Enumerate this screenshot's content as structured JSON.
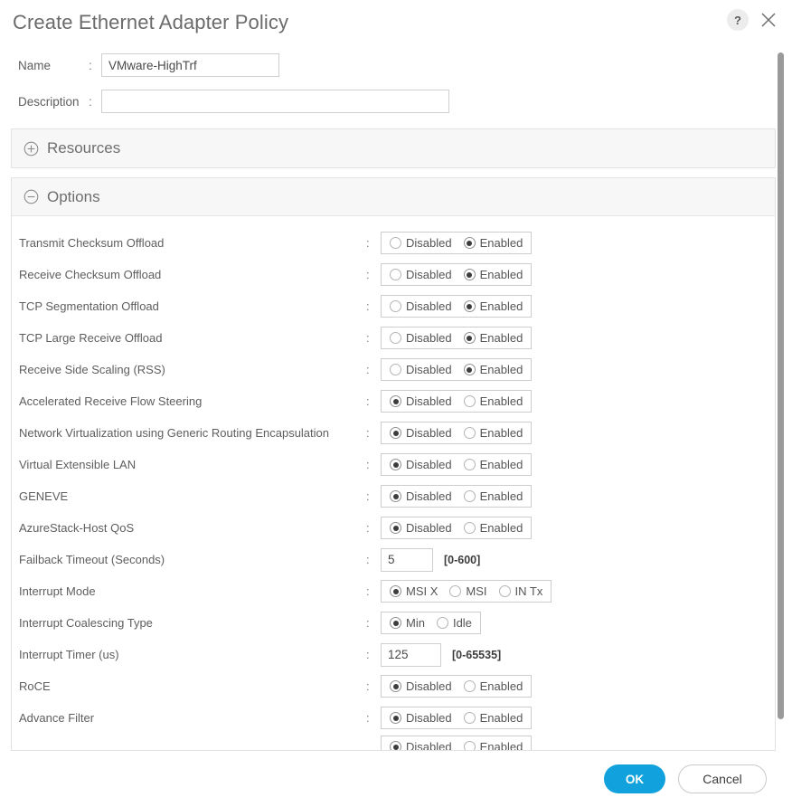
{
  "header": {
    "title": "Create Ethernet Adapter Policy",
    "help_icon": "question-mark-icon",
    "help_label": "?",
    "close_icon": "close-icon"
  },
  "form": {
    "name": {
      "label": "Name",
      "colon": ":",
      "value": "VMware-HighTrf",
      "placeholder": ""
    },
    "description": {
      "label": "Description",
      "colon": ":",
      "value": "",
      "placeholder": ""
    }
  },
  "sections": {
    "resources": {
      "title": "Resources",
      "expanded": false,
      "toggle_glyph": "plus-circle-icon"
    },
    "options": {
      "title": "Options",
      "expanded": true,
      "toggle_glyph": "minus-circle-icon"
    }
  },
  "radio_labels": {
    "disabled": "Disabled",
    "enabled": "Enabled"
  },
  "options_rows": [
    {
      "label": "Transmit Checksum Offload",
      "colon": ":",
      "type": "radio",
      "choices": [
        "Disabled",
        "Enabled"
      ],
      "selected": "Enabled"
    },
    {
      "label": "Receive Checksum Offload",
      "colon": ":",
      "type": "radio",
      "choices": [
        "Disabled",
        "Enabled"
      ],
      "selected": "Enabled"
    },
    {
      "label": "TCP Segmentation Offload",
      "colon": ":",
      "type": "radio",
      "choices": [
        "Disabled",
        "Enabled"
      ],
      "selected": "Enabled"
    },
    {
      "label": "TCP Large Receive Offload",
      "colon": ":",
      "type": "radio",
      "choices": [
        "Disabled",
        "Enabled"
      ],
      "selected": "Enabled"
    },
    {
      "label": "Receive Side Scaling (RSS)",
      "colon": ":",
      "type": "radio",
      "choices": [
        "Disabled",
        "Enabled"
      ],
      "selected": "Enabled"
    },
    {
      "label": "Accelerated Receive Flow Steering",
      "colon": ":",
      "type": "radio",
      "choices": [
        "Disabled",
        "Enabled"
      ],
      "selected": "Disabled"
    },
    {
      "label": "Network Virtualization using Generic Routing Encapsulation",
      "colon": ":",
      "type": "radio",
      "choices": [
        "Disabled",
        "Enabled"
      ],
      "selected": "Disabled"
    },
    {
      "label": "Virtual Extensible LAN",
      "colon": ":",
      "type": "radio",
      "choices": [
        "Disabled",
        "Enabled"
      ],
      "selected": "Disabled"
    },
    {
      "label": "GENEVE",
      "colon": ":",
      "type": "radio",
      "choices": [
        "Disabled",
        "Enabled"
      ],
      "selected": "Disabled"
    },
    {
      "label": "AzureStack-Host QoS",
      "colon": ":",
      "type": "radio",
      "choices": [
        "Disabled",
        "Enabled"
      ],
      "selected": "Disabled"
    },
    {
      "label": "Failback Timeout (Seconds)",
      "colon": ":",
      "type": "number",
      "value": "5",
      "range_hint": "[0-600]"
    },
    {
      "label": "Interrupt Mode",
      "colon": ":",
      "type": "radio",
      "choices": [
        "MSI X",
        "MSI",
        "IN Tx"
      ],
      "selected": "MSI X"
    },
    {
      "label": "Interrupt Coalescing Type",
      "colon": ":",
      "type": "radio",
      "choices": [
        "Min",
        "Idle"
      ],
      "selected": "Min"
    },
    {
      "label": "Interrupt Timer (us)",
      "colon": ":",
      "type": "number",
      "value": "125",
      "range_hint": "[0-65535]"
    },
    {
      "label": "RoCE",
      "colon": ":",
      "type": "radio",
      "choices": [
        "Disabled",
        "Enabled"
      ],
      "selected": "Disabled"
    },
    {
      "label": "Advance Filter",
      "colon": ":",
      "type": "radio",
      "choices": [
        "Disabled",
        "Enabled"
      ],
      "selected": "Disabled"
    },
    {
      "label": "",
      "colon": "",
      "type": "radio",
      "clipped": true,
      "choices": [
        "Disabled",
        "Enabled"
      ],
      "selected": "Disabled"
    }
  ],
  "footer": {
    "ok_label": "OK",
    "cancel_label": "Cancel"
  },
  "colors": {
    "accent_blue": "#11a2dd",
    "panel_header_bg": "#f7f7f7",
    "border": "#e2e2e2",
    "text": "#5e5e5e",
    "scrollbar": "#9a9a9a"
  },
  "scroll": {
    "thumb_position_percent": 0
  }
}
